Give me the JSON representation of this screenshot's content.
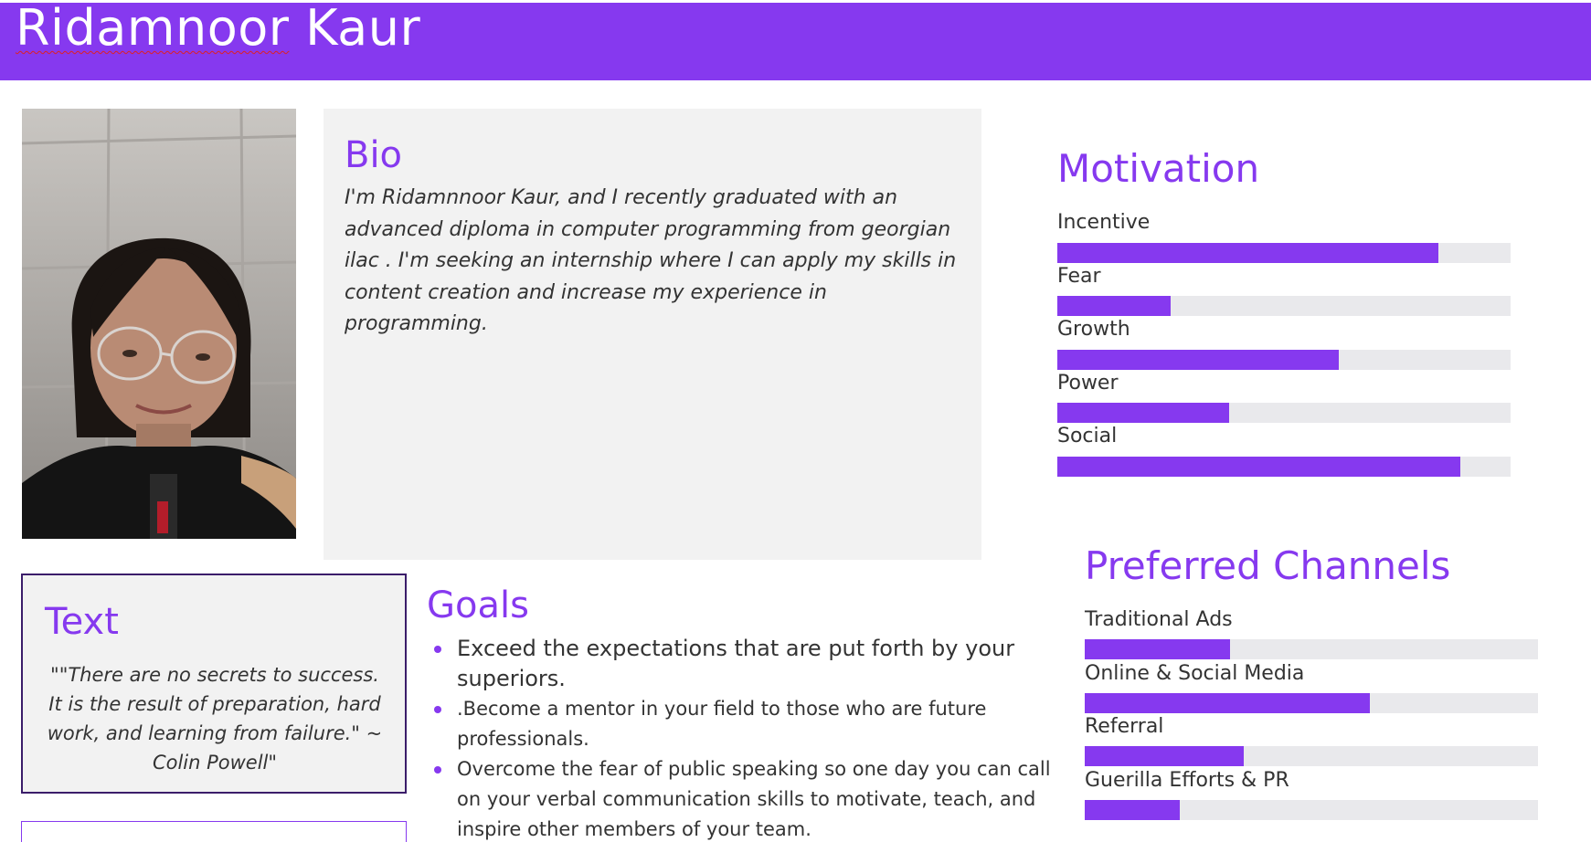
{
  "header": {
    "first_name": "Ridamnoor",
    "last_name": "Kaur"
  },
  "bio": {
    "title": "Bio",
    "text": "I'm Ridamnnoor Kaur, and I recently graduated with an advanced diploma in computer programming from georgian ilac . I'm seeking an internship where I can apply my skills in content creation and increase my experience in programming."
  },
  "quote": {
    "title": "Text",
    "text": "\"\"There are no secrets to success. It is the result of preparation, hard work, and learning from failure.\" ~ Colin Powell\""
  },
  "goals": {
    "title": "Goals",
    "items": [
      "Exceed the expectations that are put forth by your superiors.",
      ".Become a mentor in your field to those who are future professionals.",
      "Overcome the fear of public speaking so one day you can call on your verbal communication skills to motivate, teach, and inspire other members of your team."
    ]
  },
  "motivation": {
    "title": "Motivation",
    "items": [
      {
        "label": "Incentive",
        "value": 0.84
      },
      {
        "label": "Fear",
        "value": 0.25
      },
      {
        "label": "Growth",
        "value": 0.62
      },
      {
        "label": "Power",
        "value": 0.38
      },
      {
        "label": "Social",
        "value": 0.89
      }
    ]
  },
  "channels": {
    "title": "Preferred Channels",
    "items": [
      {
        "label": "Traditional Ads",
        "value": 0.32
      },
      {
        "label": "Online & Social Media",
        "value": 0.63
      },
      {
        "label": "Referral",
        "value": 0.35
      },
      {
        "label": "Guerilla Efforts & PR",
        "value": 0.21
      }
    ]
  },
  "colors": {
    "accent": "#8639ef",
    "track": "#e9e9ec",
    "panel": "#f2f2f2"
  }
}
